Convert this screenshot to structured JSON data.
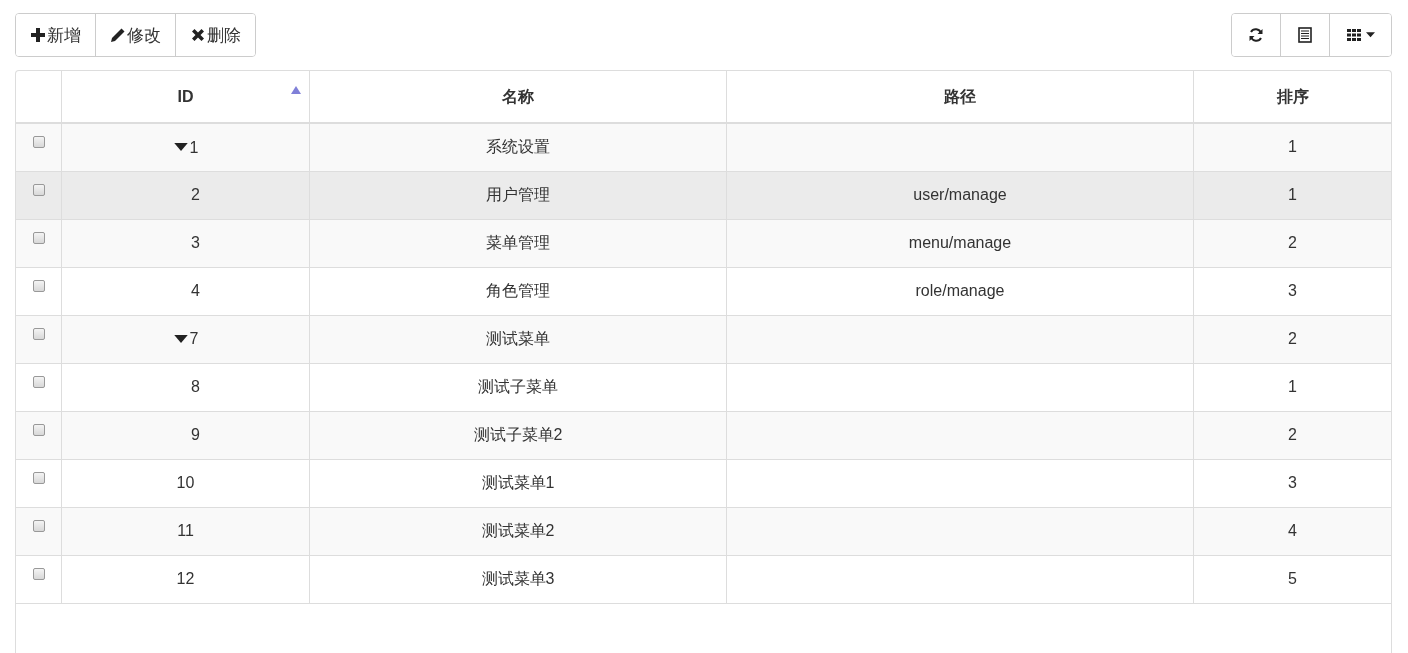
{
  "toolbar": {
    "buttons": [
      {
        "kind": "plus",
        "label": "新增"
      },
      {
        "kind": "pencil",
        "label": "修改"
      },
      {
        "kind": "cross",
        "label": "删除"
      }
    ],
    "tools": [
      {
        "kind": "refresh"
      },
      {
        "kind": "list"
      },
      {
        "kind": "columns"
      }
    ]
  },
  "table": {
    "columns": [
      {
        "label": "ID",
        "sorted": true
      },
      {
        "label": "名称",
        "sorted": false
      },
      {
        "label": "路径",
        "sorted": false
      },
      {
        "label": "排序",
        "sorted": false
      }
    ],
    "rows": [
      {
        "id": "1",
        "name": "系统设置",
        "order": "1",
        "checked": false,
        "hovered": false,
        "expanded": true,
        "children": [
          {
            "id": "2",
            "name": "用户管理",
            "path": "user/manage",
            "order": "1",
            "checked": false,
            "hovered": true
          },
          {
            "id": "3",
            "name": "菜单管理",
            "path": "menu/manage",
            "order": "2",
            "checked": false,
            "hovered": false
          },
          {
            "id": "4",
            "name": "角色管理",
            "path": "role/manage",
            "order": "3",
            "checked": false,
            "hovered": false
          }
        ]
      },
      {
        "id": "7",
        "name": "测试菜单",
        "order": "2",
        "checked": false,
        "hovered": false,
        "expanded": true,
        "children": [
          {
            "id": "8",
            "name": "测试子菜单",
            "order": "1",
            "checked": false,
            "hovered": false
          },
          {
            "id": "9",
            "name": "测试子菜单2",
            "order": "2",
            "checked": false,
            "hovered": false
          }
        ]
      },
      {
        "id": "10",
        "name": "测试菜单1",
        "order": "3",
        "checked": false,
        "hovered": false
      },
      {
        "id": "11",
        "name": "测试菜单2",
        "order": "4",
        "checked": false,
        "hovered": false
      },
      {
        "id": "12",
        "name": "测试菜单3",
        "order": "5",
        "checked": false,
        "hovered": false
      }
    ]
  }
}
